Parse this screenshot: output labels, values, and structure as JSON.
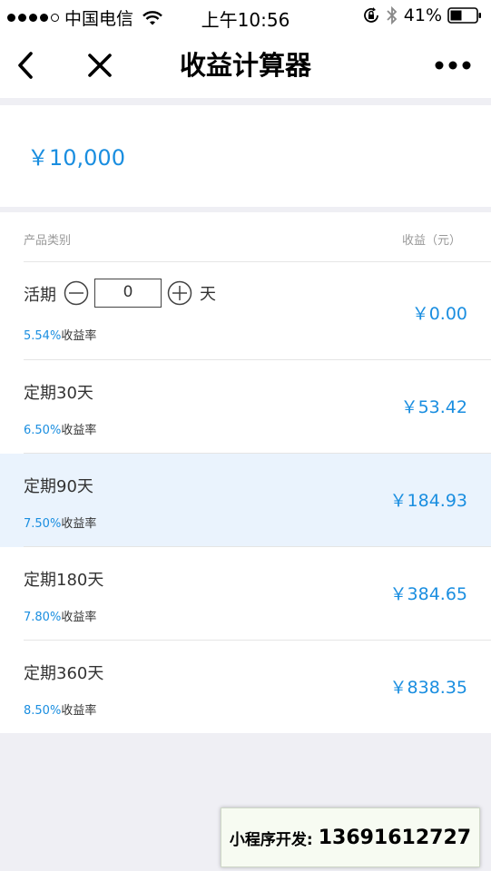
{
  "status_bar": {
    "carrier": "中国电信",
    "time": "上午10:56",
    "battery": "41%"
  },
  "nav": {
    "title": "收益计算器"
  },
  "amount": "￥10,000",
  "list": {
    "header_left": "产品类别",
    "header_right": "收益（元）",
    "demand": {
      "name": "活期",
      "days_value": "0",
      "day_unit": "天",
      "rate_pct": "5.54%",
      "rate_label": "收益率",
      "income": "￥0.00"
    },
    "items": [
      {
        "name": "定期30天",
        "rate_pct": "6.50%",
        "rate_label": "收益率",
        "income": "￥53.42"
      },
      {
        "name": "定期90天",
        "rate_pct": "7.50%",
        "rate_label": "收益率",
        "income": "￥184.93"
      },
      {
        "name": "定期180天",
        "rate_pct": "7.80%",
        "rate_label": "收益率",
        "income": "￥384.65"
      },
      {
        "name": "定期360天",
        "rate_pct": "8.50%",
        "rate_label": "收益率",
        "income": "￥838.35"
      }
    ]
  },
  "watermark": {
    "label": "小程序开发:",
    "phone": "13691612727"
  },
  "colors": {
    "accent": "#1a8ee0",
    "highlight_row": "#eaf3fd",
    "background": "#efeff4"
  },
  "icons": [
    "signal-icon",
    "wifi-icon",
    "rotation-lock-icon",
    "bluetooth-icon",
    "battery-icon",
    "back-icon",
    "close-icon",
    "more-icon",
    "minus-icon",
    "plus-icon"
  ]
}
